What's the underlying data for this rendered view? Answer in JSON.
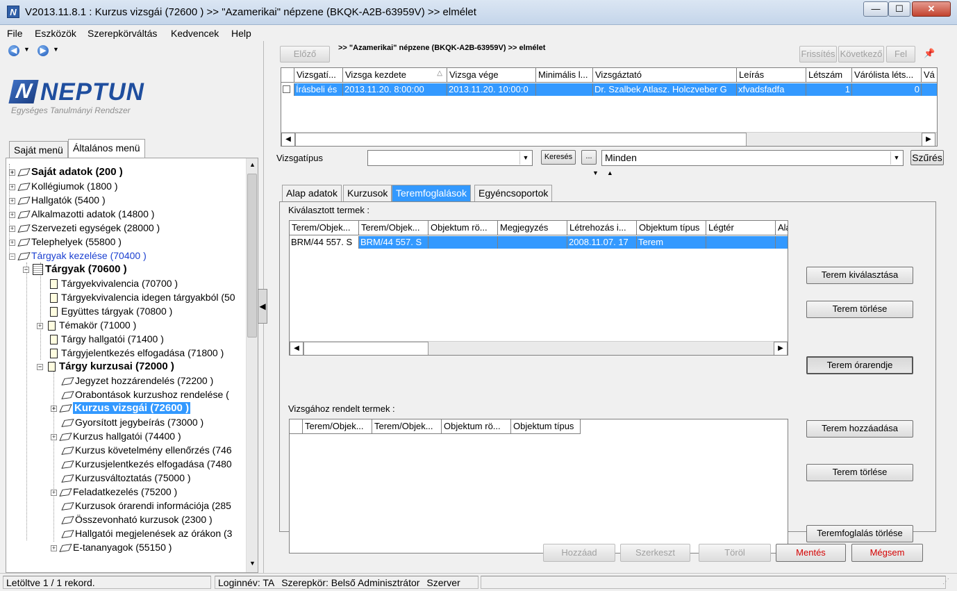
{
  "window": {
    "title": "V2013.11.8.1 : Kurzus vizsgái (72600  )  >> \"Azamerikai\" népzene (BKQK-A2B-63959V) >> elmélet",
    "icon": "N",
    "min": "—",
    "max": "☐",
    "close": "✕"
  },
  "menu": [
    "File",
    "Eszközök",
    "Szerepkörváltás",
    "Kedvencek",
    "Help"
  ],
  "nav": {
    "back": "◀",
    "forward": "▶",
    "drop": "▼"
  },
  "logo": {
    "mark": "N",
    "word": "NEPTUN",
    "subtitle": "Egységes Tanulmányi Rendszer"
  },
  "left_tabs": [
    "Saját menü",
    "Általános menü"
  ],
  "tree": [
    {
      "label": "Saját adatok (200  )"
    },
    {
      "label": "Kollégiumok (1800  )"
    },
    {
      "label": "Hallgatók (5400  )"
    },
    {
      "label": "Alkalmazotti adatok (14800  )"
    },
    {
      "label": "Szervezeti egységek (28000  )"
    },
    {
      "label": "Telephelyek (55800  )"
    },
    {
      "label": "Tárgyak kezelése (70400  )"
    },
    {
      "label": "Tárgyak (70600  )"
    },
    {
      "label": "Tárgyekvivalencia (70700  )"
    },
    {
      "label": "Tárgyekvivalencia idegen tárgyakból (50"
    },
    {
      "label": "Együttes tárgyak (70800  )"
    },
    {
      "label": "Témakör (71000  )"
    },
    {
      "label": "Tárgy hallgatói (71400  )"
    },
    {
      "label": "Tárgyjelentkezés elfogadása (71800  )"
    },
    {
      "label": "Tárgy kurzusai (72000  )"
    },
    {
      "label": "Jegyzet hozzárendelés (72200  )"
    },
    {
      "label": "Orabontások kurzushoz rendelése ("
    },
    {
      "label": "Kurzus vizsgái (72600  )"
    },
    {
      "label": "Gyorsított jegybeírás (73000  )"
    },
    {
      "label": "Kurzus hallgatói (74400  )"
    },
    {
      "label": "Kurzus követelmény ellenőrzés (746"
    },
    {
      "label": "Kurzusjelentkezés elfogadása (7480"
    },
    {
      "label": "Kurzusváltoztatás (75000  )"
    },
    {
      "label": "Feladatkezelés (75200  )"
    },
    {
      "label": "Kurzusok órarendi információja (285"
    },
    {
      "label": "Összevonható kurzusok (2300  )"
    },
    {
      "label": "Hallgatói megjelenések az órákon (3"
    },
    {
      "label": "E-tananyagok (55150  )"
    }
  ],
  "top_nav": {
    "prev": "Előző",
    "breadcrumb": ">> \"Azamerikai\" népzene (BKQK-A2B-63959V) >> elmélet",
    "refresh": "Frissítés",
    "next": "Következő",
    "up": "Fel",
    "pin": "📌"
  },
  "exam_grid": {
    "headers": [
      "Vizsgatí...",
      "Vizsga kezdete",
      "Vizsga vége",
      "Minimális l...",
      "Vizsgáztató",
      "Leírás",
      "Létszám",
      "Várólista léts...",
      "Vá"
    ],
    "sort_indicator": "△",
    "row": [
      "Írásbeli és",
      "2013.11.20. 8:00:00",
      "2013.11.20. 10:00:0",
      "",
      "Dr. Szalbek Atlasz. Holczveber G",
      "xfvadsfadfa",
      "1",
      "0",
      ""
    ]
  },
  "filter": {
    "label": "Vizsgatípus",
    "type_value": "",
    "search": "Keresés",
    "ellipsis": "...",
    "scope_value": "Minden",
    "filter_btn": "Szűrés"
  },
  "collapse": {
    "down": "▼",
    "up": "▲"
  },
  "detail_tabs": [
    "Alap adatok",
    "Kurzusok",
    "Teremfoglalások",
    "Egyéncsoportok"
  ],
  "selected_rooms": {
    "label": "Kiválasztott termek :",
    "headers": [
      "Terem/Objek...",
      "Terem/Objek...",
      "Objektum rö...",
      "Megjegyzés",
      "Létrehozás i...",
      "Objektum típus",
      "Légtér",
      "Ala"
    ],
    "row": [
      "BRM/44 557. S",
      "BRM/44 557. S",
      "",
      "",
      "2008.11.07. 17",
      "Terem",
      "",
      ""
    ]
  },
  "exam_rooms": {
    "label": "Vizsgához rendelt termek :",
    "headers": [
      "",
      "Terem/Objek...",
      "Terem/Objek...",
      "Objektum rö...",
      "Objektum típus"
    ]
  },
  "side_buttons": {
    "select_room": "Terem kiválasztása",
    "delete_room1": "Terem törlése",
    "room_schedule": "Terem órarendje",
    "add_room": "Terem hozzáadása",
    "delete_room2": "Terem törlése",
    "delete_booking": "Teremfoglalás törlése"
  },
  "bottom_buttons": {
    "add": "Hozzáad",
    "edit": "Szerkeszt",
    "delete": "Töröl",
    "save": "Mentés",
    "cancel": "Mégsem"
  },
  "status": {
    "records": "Letöltve 1 / 1 rekord.",
    "login": "Loginnév: TA",
    "role": "Szerepkör: Belső Adminisztrátor",
    "server": "Szerver"
  },
  "colors": {
    "selection": "#3399ff",
    "brand": "#1f4e9e",
    "danger": "#d40000"
  }
}
